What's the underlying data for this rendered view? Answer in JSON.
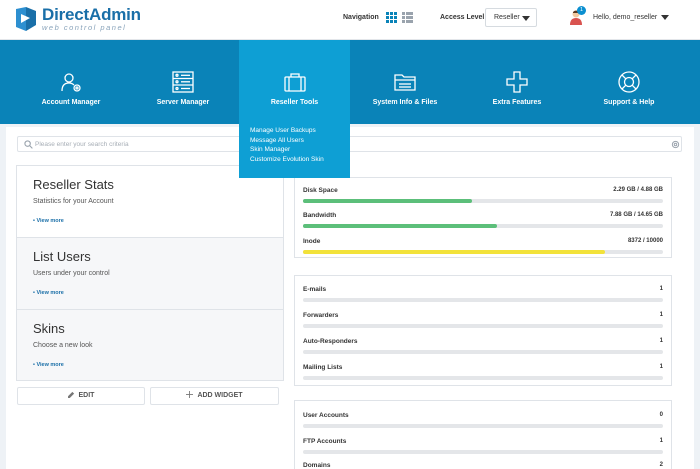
{
  "header": {
    "logo_title": "DirectAdmin",
    "logo_subtitle": "web control panel",
    "navigation_label": "Navigation",
    "access_label": "Access Level",
    "access_value": "Reseller",
    "notification_count": "1",
    "hello_prefix": "Hello,",
    "username": "demo_reseller"
  },
  "nav": {
    "items": [
      {
        "label": "Account Manager",
        "icon": "account-manager-icon"
      },
      {
        "label": "Server Manager",
        "icon": "server-icon"
      },
      {
        "label": "Reseller Tools",
        "icon": "briefcase-icon"
      },
      {
        "label": "System Info & Files",
        "icon": "folder-icon"
      },
      {
        "label": "Extra Features",
        "icon": "plus-icon"
      },
      {
        "label": "Support & Help",
        "icon": "lifebuoy-icon"
      }
    ],
    "dropdown": [
      "Manage User Backups",
      "Message All Users",
      "Skin Manager",
      "Customize Evolution Skin"
    ]
  },
  "search": {
    "placeholder": "Please enter your search criteria"
  },
  "widgets": [
    {
      "title": "Reseller Stats",
      "desc": "Statistics for your Account",
      "more": "• View more"
    },
    {
      "title": "List Users",
      "desc": "Users under your control",
      "more": "• View more"
    },
    {
      "title": "Skins",
      "desc": "Choose a new look",
      "more": "• View more"
    }
  ],
  "buttons": {
    "edit": "EDIT",
    "add_widget": "ADD WIDGET"
  },
  "usage": [
    {
      "name": "Disk Space",
      "value": "2.29 GB / 4.88 GB",
      "fraction": 0.47,
      "color": "#5cbf7a"
    },
    {
      "name": "Bandwidth",
      "value": "7.88 GB / 14.65 GB",
      "fraction": 0.54,
      "color": "#5cbf7a"
    },
    {
      "name": "Inode",
      "value": "8372 / 10000",
      "fraction": 0.84,
      "color": "#f2e23a"
    }
  ],
  "email_stats": [
    {
      "name": "E-mails",
      "value": "1"
    },
    {
      "name": "Forwarders",
      "value": "1"
    },
    {
      "name": "Auto-Responders",
      "value": "1"
    },
    {
      "name": "Mailing Lists",
      "value": "1"
    }
  ],
  "account_stats": [
    {
      "name": "User Accounts",
      "value": "0"
    },
    {
      "name": "FTP Accounts",
      "value": "1"
    },
    {
      "name": "Domains",
      "value": "2"
    }
  ]
}
